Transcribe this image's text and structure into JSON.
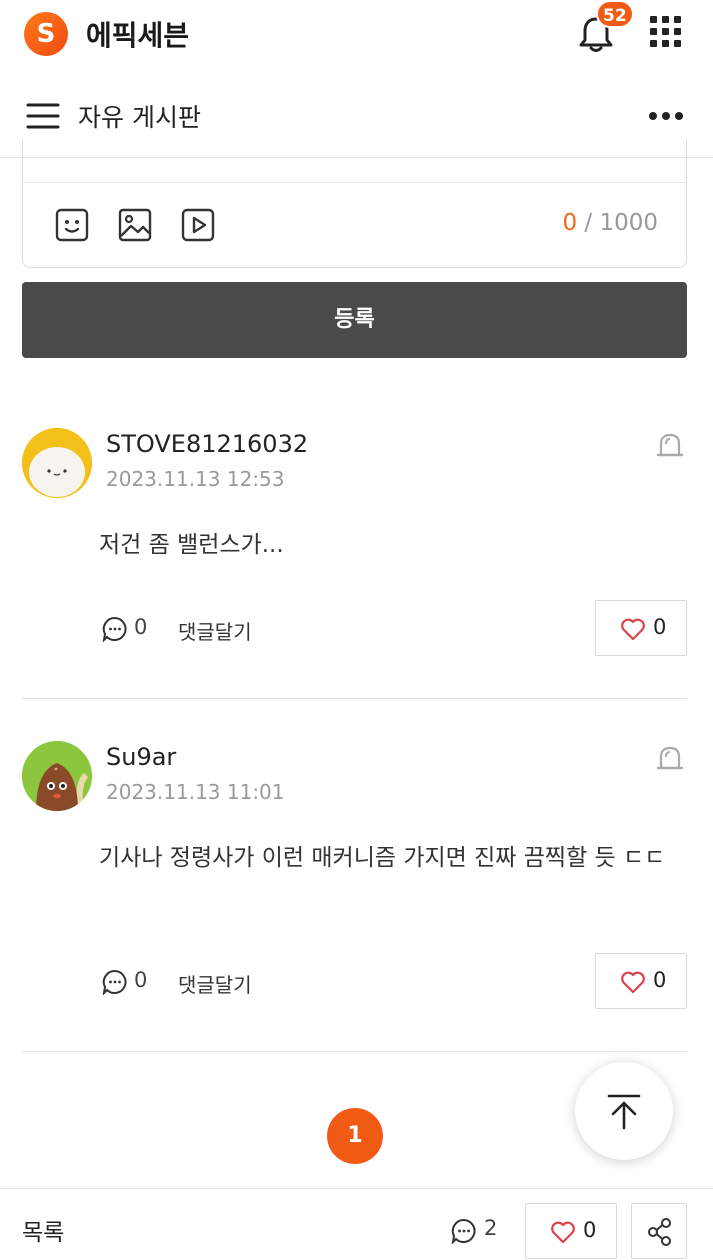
{
  "app": {
    "logo_letter": "S",
    "name": "에픽세븐",
    "notification_count": "52"
  },
  "board": {
    "title": "자유 게시판"
  },
  "composer": {
    "char_count": "0",
    "char_limit": "/ 1000",
    "submit_label": "등록"
  },
  "comments": [
    {
      "author": "STOVE81216032",
      "date": "2023.11.13 12:53",
      "text": "저건 좀 밸런스가...",
      "reply_count": "0",
      "reply_label": "댓글달기",
      "likes": "0"
    },
    {
      "author": "Su9ar",
      "date": "2023.11.13 11:01",
      "text": "기사나 정령사가 이런 매커니즘 가지면 진짜 끔찍할 듯 ㄷㄷ",
      "reply_count": "0",
      "reply_label": "댓글달기",
      "likes": "0"
    }
  ],
  "pagination": {
    "current": "1"
  },
  "bottom_bar": {
    "list_label": "목록",
    "comment_count": "2",
    "like_count": "0"
  },
  "colors": {
    "accent": "#f05a14",
    "submit_bg": "#4a4a4a",
    "like_heart": "#d9434a"
  }
}
